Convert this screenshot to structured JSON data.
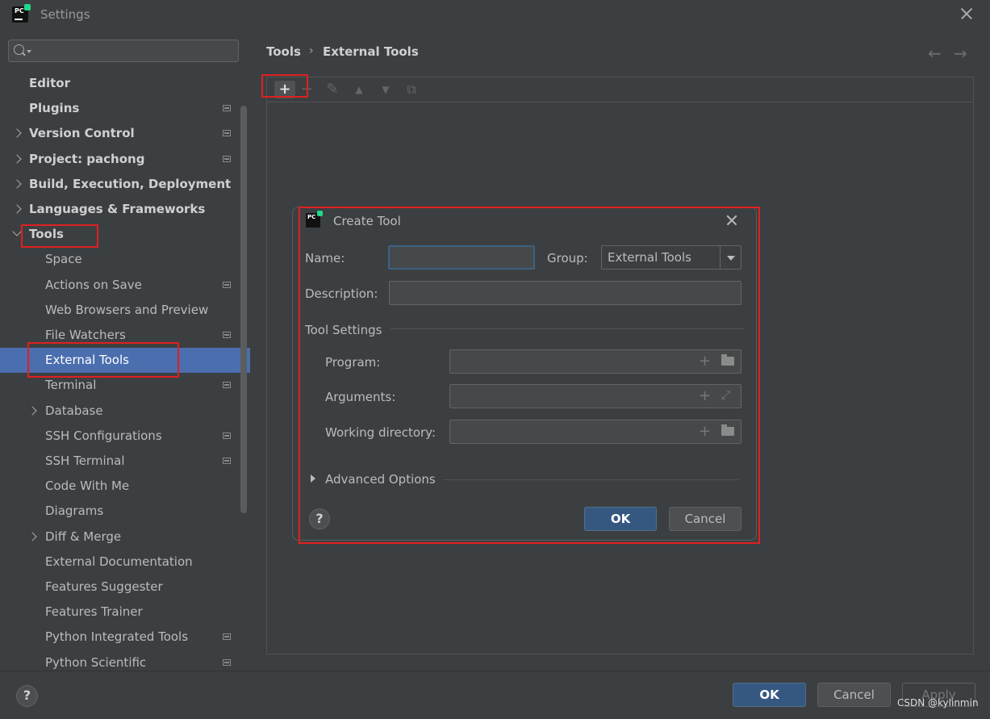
{
  "window": {
    "title": "Settings"
  },
  "search": {
    "placeholder": ""
  },
  "tree": [
    {
      "label": "Editor",
      "bold": true,
      "indent": 0,
      "chevron": "none",
      "icon": false
    },
    {
      "label": "Plugins",
      "bold": true,
      "indent": 0,
      "chevron": "none",
      "icon": true
    },
    {
      "label": "Version Control",
      "bold": true,
      "indent": 0,
      "chevron": "right",
      "icon": true
    },
    {
      "label": "Project: pachong",
      "bold": true,
      "indent": 0,
      "chevron": "right",
      "icon": true
    },
    {
      "label": "Build, Execution, Deployment",
      "bold": true,
      "indent": 0,
      "chevron": "right",
      "icon": false
    },
    {
      "label": "Languages & Frameworks",
      "bold": true,
      "indent": 0,
      "chevron": "right",
      "icon": false
    },
    {
      "label": "Tools",
      "bold": true,
      "indent": 0,
      "chevron": "down",
      "icon": false
    },
    {
      "label": "Space",
      "bold": false,
      "indent": 1,
      "chevron": "none",
      "icon": false
    },
    {
      "label": "Actions on Save",
      "bold": false,
      "indent": 1,
      "chevron": "none",
      "icon": true
    },
    {
      "label": "Web Browsers and Preview",
      "bold": false,
      "indent": 1,
      "chevron": "none",
      "icon": false
    },
    {
      "label": "File Watchers",
      "bold": false,
      "indent": 1,
      "chevron": "none",
      "icon": true
    },
    {
      "label": "External Tools",
      "bold": false,
      "indent": 1,
      "chevron": "none",
      "icon": false,
      "selected": true
    },
    {
      "label": "Terminal",
      "bold": false,
      "indent": 1,
      "chevron": "none",
      "icon": true
    },
    {
      "label": "Database",
      "bold": false,
      "indent": 1,
      "chevron": "right",
      "icon": false
    },
    {
      "label": "SSH Configurations",
      "bold": false,
      "indent": 1,
      "chevron": "none",
      "icon": true
    },
    {
      "label": "SSH Terminal",
      "bold": false,
      "indent": 1,
      "chevron": "none",
      "icon": true
    },
    {
      "label": "Code With Me",
      "bold": false,
      "indent": 1,
      "chevron": "none",
      "icon": false
    },
    {
      "label": "Diagrams",
      "bold": false,
      "indent": 1,
      "chevron": "none",
      "icon": false
    },
    {
      "label": "Diff & Merge",
      "bold": false,
      "indent": 1,
      "chevron": "right",
      "icon": false
    },
    {
      "label": "External Documentation",
      "bold": false,
      "indent": 1,
      "chevron": "none",
      "icon": false
    },
    {
      "label": "Features Suggester",
      "bold": false,
      "indent": 1,
      "chevron": "none",
      "icon": false
    },
    {
      "label": "Features Trainer",
      "bold": false,
      "indent": 1,
      "chevron": "none",
      "icon": false
    },
    {
      "label": "Python Integrated Tools",
      "bold": false,
      "indent": 1,
      "chevron": "none",
      "icon": true
    },
    {
      "label": "Python Scientific",
      "bold": false,
      "indent": 1,
      "chevron": "none",
      "icon": true
    }
  ],
  "breadcrumb": {
    "parent": "Tools",
    "separator": "›",
    "current": "External Tools"
  },
  "toolbar": {
    "add": "+",
    "remove": "−",
    "edit": "✎",
    "up": "▲",
    "down": "▼",
    "copy": "⧉"
  },
  "dialog": {
    "title": "Create Tool",
    "name_label": "Name:",
    "name_value": "",
    "group_label": "Group:",
    "group_value": "External Tools",
    "description_label": "Description:",
    "description_value": "",
    "tool_settings_label": "Tool Settings",
    "program_label": "Program:",
    "arguments_label": "Arguments:",
    "working_dir_label": "Working directory:",
    "advanced_label": "Advanced Options",
    "help": "?",
    "ok": "OK",
    "cancel": "Cancel"
  },
  "footer": {
    "help": "?",
    "ok": "OK",
    "cancel": "Cancel",
    "apply": "Apply"
  },
  "watermark": "CSDN @kylinmin",
  "colors": {
    "selection": "#4b6eaf",
    "primary_button": "#365880",
    "annotation_red": "#e0201f",
    "brand_green": "#21d789"
  }
}
